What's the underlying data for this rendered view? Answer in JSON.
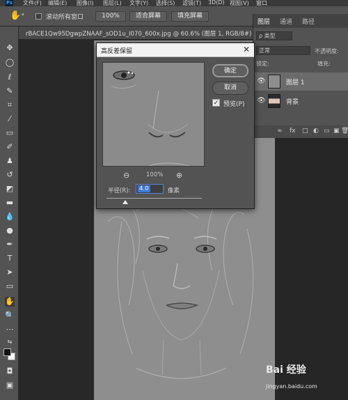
{
  "app": {
    "logo": "Ps"
  },
  "menu": {
    "items": [
      "文件(F)",
      "编辑(E)",
      "图像(I)",
      "图层(L)",
      "文字(Y)",
      "选择(S)",
      "滤镜(T)",
      "3D(D)",
      "视图(V)",
      "窗口"
    ]
  },
  "options": {
    "scroll_all_windows": "滚动所有窗口",
    "zoom_value": "100%",
    "fit_screen": "适合屏幕",
    "fill_screen": "填充屏幕"
  },
  "document": {
    "tab_title": "rBACE1Qw95DgwpZNAAF_sOD1u_I070_600x.jpg @ 60.6% (图层 1, RGB/8#) *"
  },
  "panel": {
    "tabs": [
      "图层",
      "通道",
      "路径"
    ],
    "search_placeholder": "ρ 类型",
    "blend_mode": "正常",
    "opacity_label": "不透明度:",
    "lock_label": "锁定:",
    "fill_label": "填充:",
    "layers": [
      {
        "name": "图层 1",
        "selected": true
      },
      {
        "name": "背景",
        "selected": false
      }
    ],
    "bottom_icons": [
      "∞",
      "fx",
      "□",
      "◐",
      "▭",
      "▣",
      "🗑"
    ]
  },
  "dialog": {
    "title": "高反差保留",
    "ok": "确定",
    "cancel": "取消",
    "preview_label": "预览(P)",
    "preview_checked": "✓",
    "zoom_value": "100%",
    "radius_label": "半径(R):",
    "radius_value": "4.0",
    "radius_unit": "像素"
  },
  "watermark": {
    "brand": "Bai 经验",
    "url": "jingyan.baidu.com"
  }
}
